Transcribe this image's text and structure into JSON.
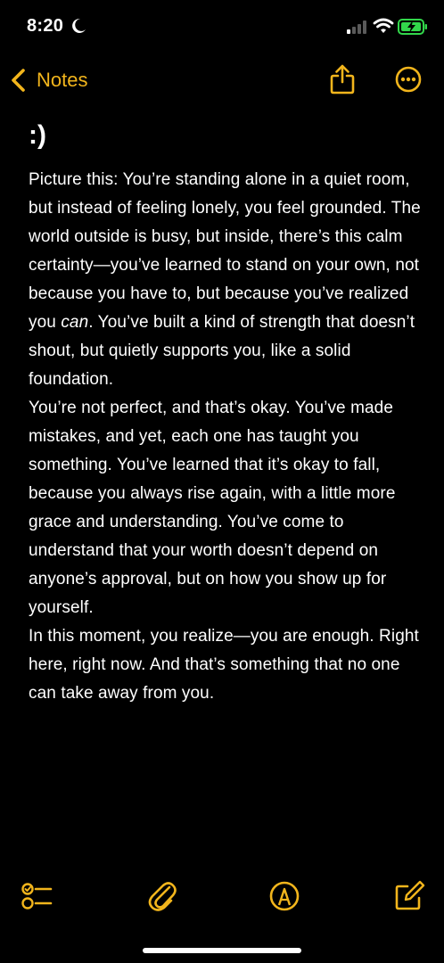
{
  "status_bar": {
    "time": "8:20"
  },
  "nav": {
    "back_label": "Notes"
  },
  "note": {
    "title": ":)",
    "paragraphs": [
      {
        "before": "Picture this: You’re standing alone in a quiet room, but instead of feeling lonely, you feel grounded. The world outside is busy, but inside, there’s this calm certainty—you’ve learned to stand on your own, not because you have to, but because you’ve realized you ",
        "emphasis": "can",
        "after": ". You’ve built a kind of strength that doesn’t shout, but quietly supports you, like a solid foundation."
      },
      {
        "text": "You’re not perfect, and that’s okay. You’ve made mistakes, and yet, each one has taught you something. You’ve learned that it’s okay to fall, because you always rise again, with a little more grace and understanding. You’ve come to understand that your worth doesn’t depend on anyone’s approval, but on how you show up for yourself."
      },
      {
        "text": "In this moment, you realize—you are enough. Right here, right now. And that’s something that no one can take away from you."
      }
    ]
  },
  "colors": {
    "accent": "#f2b51c",
    "background": "#000000",
    "text": "#ffffff"
  },
  "icons": {
    "status": [
      "moon-icon",
      "signal-icon",
      "wifi-icon",
      "battery-charging-icon"
    ],
    "nav": [
      "chevron-left-icon",
      "share-icon",
      "more-icon"
    ],
    "toolbar": [
      "checklist-icon",
      "paperclip-icon",
      "markup-pen-icon",
      "compose-icon"
    ]
  }
}
